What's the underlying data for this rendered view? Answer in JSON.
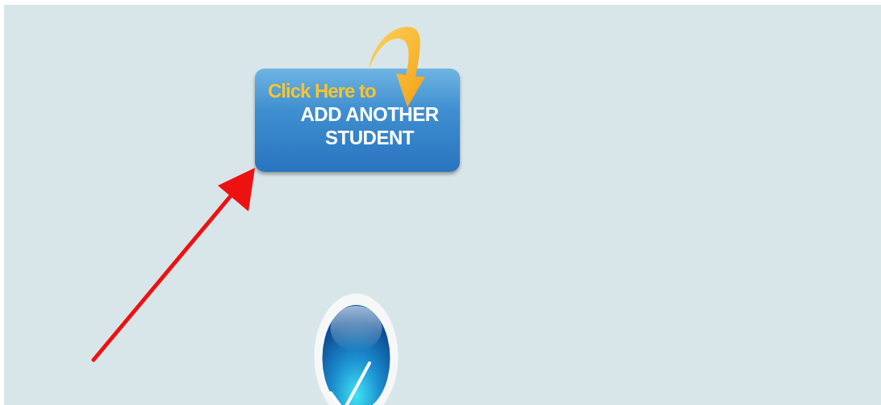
{
  "add_button": {
    "lead": "Click Here to",
    "label_lines": [
      "ADD ANOTHER",
      "STUDENT"
    ]
  },
  "confirm_button": {
    "kind": "checkmark"
  }
}
